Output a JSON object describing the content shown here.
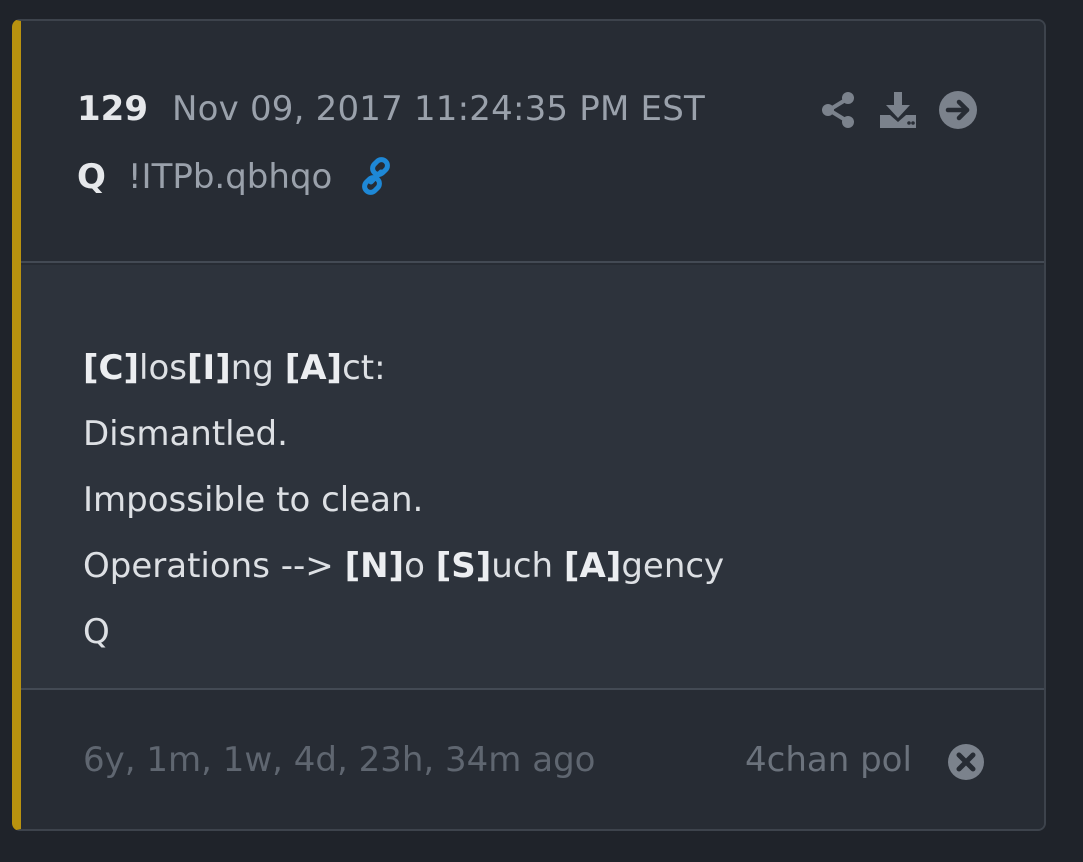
{
  "post": {
    "number": "129",
    "date": "Nov 09, 2017 11:24:35 PM EST",
    "author": "Q",
    "tripcode": "!ITPb.qbhqo"
  },
  "body_lines": [
    [
      {
        "t": "[C]",
        "b": true
      },
      {
        "t": "los",
        "b": false
      },
      {
        "t": "[I]",
        "b": true
      },
      {
        "t": "ng ",
        "b": false
      },
      {
        "t": "[A]",
        "b": true
      },
      {
        "t": "ct:",
        "b": false
      }
    ],
    [
      {
        "t": "Dismantled.",
        "b": false
      }
    ],
    [
      {
        "t": "Impossible to clean.",
        "b": false
      }
    ],
    [
      {
        "t": "Operations --> ",
        "b": false
      },
      {
        "t": "[N]",
        "b": true
      },
      {
        "t": "o ",
        "b": false
      },
      {
        "t": "[S]",
        "b": true
      },
      {
        "t": "uch ",
        "b": false
      },
      {
        "t": "[A]",
        "b": true
      },
      {
        "t": "gency",
        "b": false
      }
    ],
    [
      {
        "t": "Q",
        "b": false
      }
    ]
  ],
  "footer": {
    "age": "6y, 1m, 1w, 4d, 23h, 34m ago",
    "source": "4chan pol"
  },
  "icons": {
    "link": "link-icon",
    "share": "share-icon",
    "download": "download-icon",
    "goto": "arrow-right-circle-icon",
    "close": "close-circle-icon"
  },
  "colors": {
    "accent_bar": "#b8920f",
    "link_blue": "#1e88d6",
    "icon_gray": "#7b828c"
  }
}
